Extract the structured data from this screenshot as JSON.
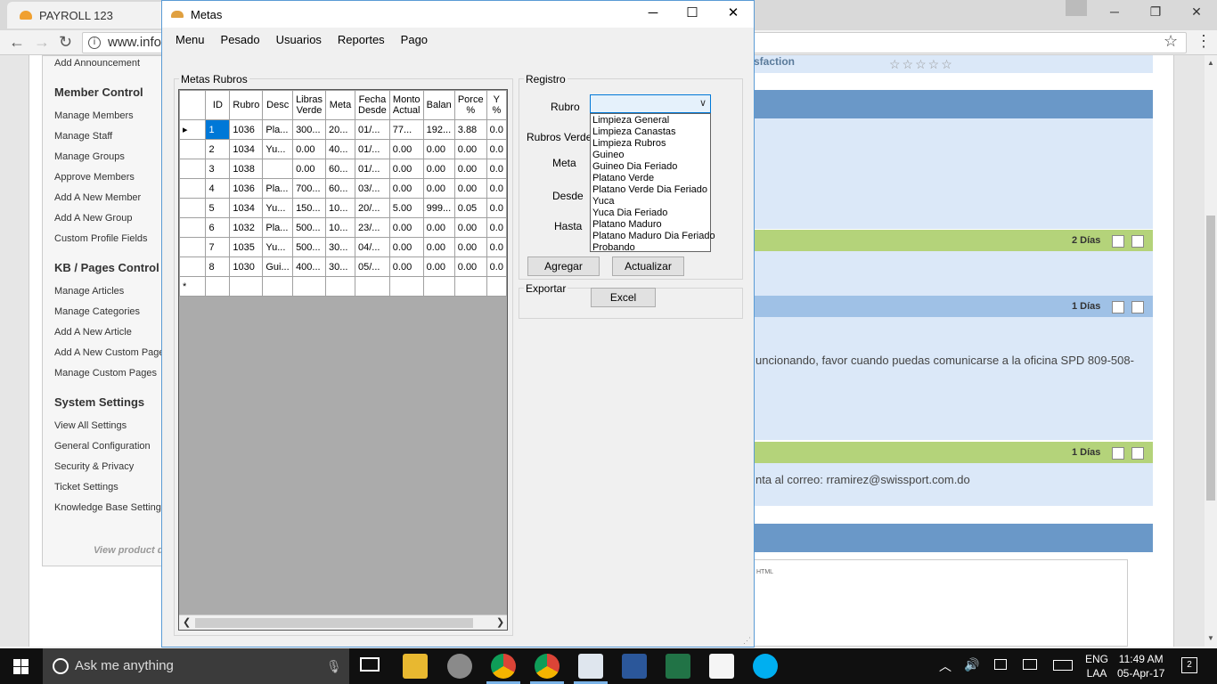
{
  "browser": {
    "tab_title": "PAYROLL 123",
    "url": "www.infor"
  },
  "sidebar": {
    "top_link": "Add Announcement",
    "sections": [
      {
        "title": "Member Control",
        "items": [
          "Manage Members",
          "Manage Staff",
          "Manage Groups",
          "Approve Members",
          "Add A New Member",
          "Add A New Group",
          "Custom Profile Fields"
        ]
      },
      {
        "title": "KB / Pages Control",
        "items": [
          "Manage Articles",
          "Manage Categories",
          "Add A New Article",
          "Add A New Custom Page",
          "Manage Custom Pages"
        ]
      },
      {
        "title": "System Settings",
        "items": [
          "View All Settings",
          "General Configuration",
          "Security & Privacy",
          "Ticket Settings",
          "Knowledge Base Settings"
        ]
      }
    ],
    "footer": "View product d"
  },
  "page_right": {
    "satisfaction_label": "sfaction",
    "stars": "☆☆☆☆☆",
    "days": [
      "2 Días",
      "1 Días",
      "1 Días"
    ],
    "message1": "uncionando, favor cuando puedas comunicarse a la oficina SPD 809-508-",
    "message2": "nta al correo:  rramirez@swissport.com.do",
    "editor_label": "HTML"
  },
  "metas": {
    "title": "Metas",
    "menu": [
      "Menu",
      "Pesado",
      "Usuarios",
      "Reportes",
      "Pago"
    ],
    "group_rubros": "Metas Rubros",
    "group_registro": "Registro",
    "group_exportar": "Exportar",
    "columns": [
      "ID",
      "Rubro",
      "Desc",
      "Libras Verde",
      "Meta",
      "Fecha Desde",
      "Monto Actual",
      "Balan",
      "Porce %",
      "Y %"
    ],
    "rows": [
      [
        "1",
        "1036",
        "Pla...",
        "300...",
        "20...",
        "01/...",
        "77...",
        "192...",
        "3.88",
        "0.0"
      ],
      [
        "2",
        "1034",
        "Yu...",
        "0.00",
        "40...",
        "01/...",
        "0.00",
        "0.00",
        "0.00",
        "0.0"
      ],
      [
        "3",
        "1038",
        "",
        "0.00",
        "60...",
        "01/...",
        "0.00",
        "0.00",
        "0.00",
        "0.0"
      ],
      [
        "4",
        "1036",
        "Pla...",
        "700...",
        "60...",
        "03/...",
        "0.00",
        "0.00",
        "0.00",
        "0.0"
      ],
      [
        "5",
        "1034",
        "Yu...",
        "150...",
        "10...",
        "20/...",
        "5.00",
        "999...",
        "0.05",
        "0.0"
      ],
      [
        "6",
        "1032",
        "Pla...",
        "500...",
        "10...",
        "23/...",
        "0.00",
        "0.00",
        "0.00",
        "0.0"
      ],
      [
        "7",
        "1035",
        "Yu...",
        "500...",
        "30...",
        "04/...",
        "0.00",
        "0.00",
        "0.00",
        "0.0"
      ],
      [
        "8",
        "1030",
        "Gui...",
        "400...",
        "30...",
        "05/...",
        "0.00",
        "0.00",
        "0.00",
        "0.0"
      ]
    ],
    "new_row_marker": "*",
    "labels": {
      "rubro": "Rubro",
      "rubros_verde": "Rubros Verde",
      "meta": "Meta",
      "desde": "Desde",
      "hasta": "Hasta"
    },
    "rubro_value": "",
    "rubro_options": [
      "Limpieza General",
      "Limpieza Canastas",
      "Limpieza Rubros",
      "Guineo",
      "Guineo Dia Feriado",
      "Platano Verde",
      "Platano Verde Dia Feriado",
      "Yuca",
      "Yuca Dia Feriado",
      "Platano Maduro",
      "Platano Maduro Dia Feriado",
      "Probando"
    ],
    "buttons": {
      "agregar": "Agregar",
      "actualizar": "Actualizar",
      "excel": "Excel"
    }
  },
  "taskbar": {
    "search_placeholder": "Ask me anything",
    "lang_top": "ENG",
    "lang_bottom": "LAA",
    "time": "11:49 AM",
    "date": "05-Apr-17",
    "notifications": "2"
  }
}
